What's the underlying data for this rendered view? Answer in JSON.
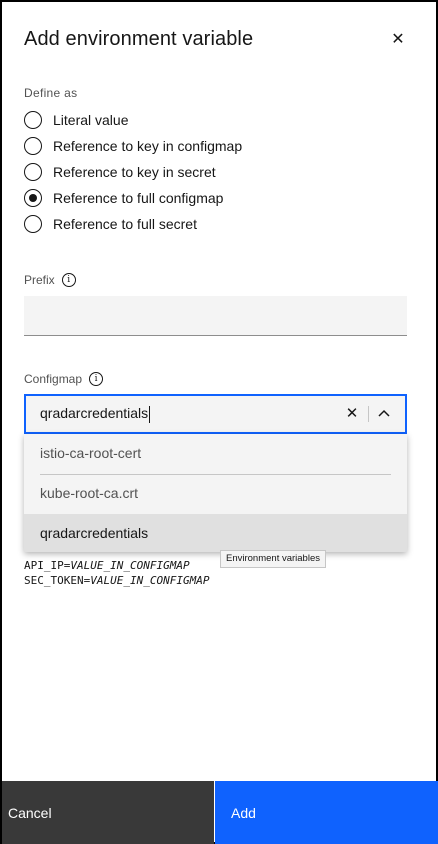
{
  "modal": {
    "title": "Add environment variable",
    "close_icon": "close-icon"
  },
  "define_as": {
    "label": "Define as",
    "options": [
      {
        "label": "Literal value",
        "checked": false
      },
      {
        "label": "Reference to key in configmap",
        "checked": false
      },
      {
        "label": "Reference to key in secret",
        "checked": false
      },
      {
        "label": "Reference to full configmap",
        "checked": true
      },
      {
        "label": "Reference to full secret",
        "checked": false
      }
    ]
  },
  "prefix": {
    "label": "Prefix",
    "value": "",
    "info_icon": "info-icon"
  },
  "configmap": {
    "label": "Configmap",
    "value": "qradarcredentials",
    "info_icon": "info-icon",
    "options": [
      {
        "label": "istio-ca-root-cert",
        "selected": false
      },
      {
        "label": "kube-root-ca.crt",
        "selected": false
      },
      {
        "label": "qradarcredentials",
        "selected": true
      }
    ]
  },
  "tooltip": "Environment variables",
  "code_preview": [
    {
      "key": "API_IP=",
      "value": "VALUE_IN_CONFIGMAP"
    },
    {
      "key": "SEC_TOKEN=",
      "value": "VALUE_IN_CONFIGMAP"
    }
  ],
  "footer": {
    "cancel_label": "Cancel",
    "add_label": "Add"
  },
  "colors": {
    "primary": "#0f62fe",
    "secondary": "#393939",
    "field_bg": "#f4f4f4"
  }
}
